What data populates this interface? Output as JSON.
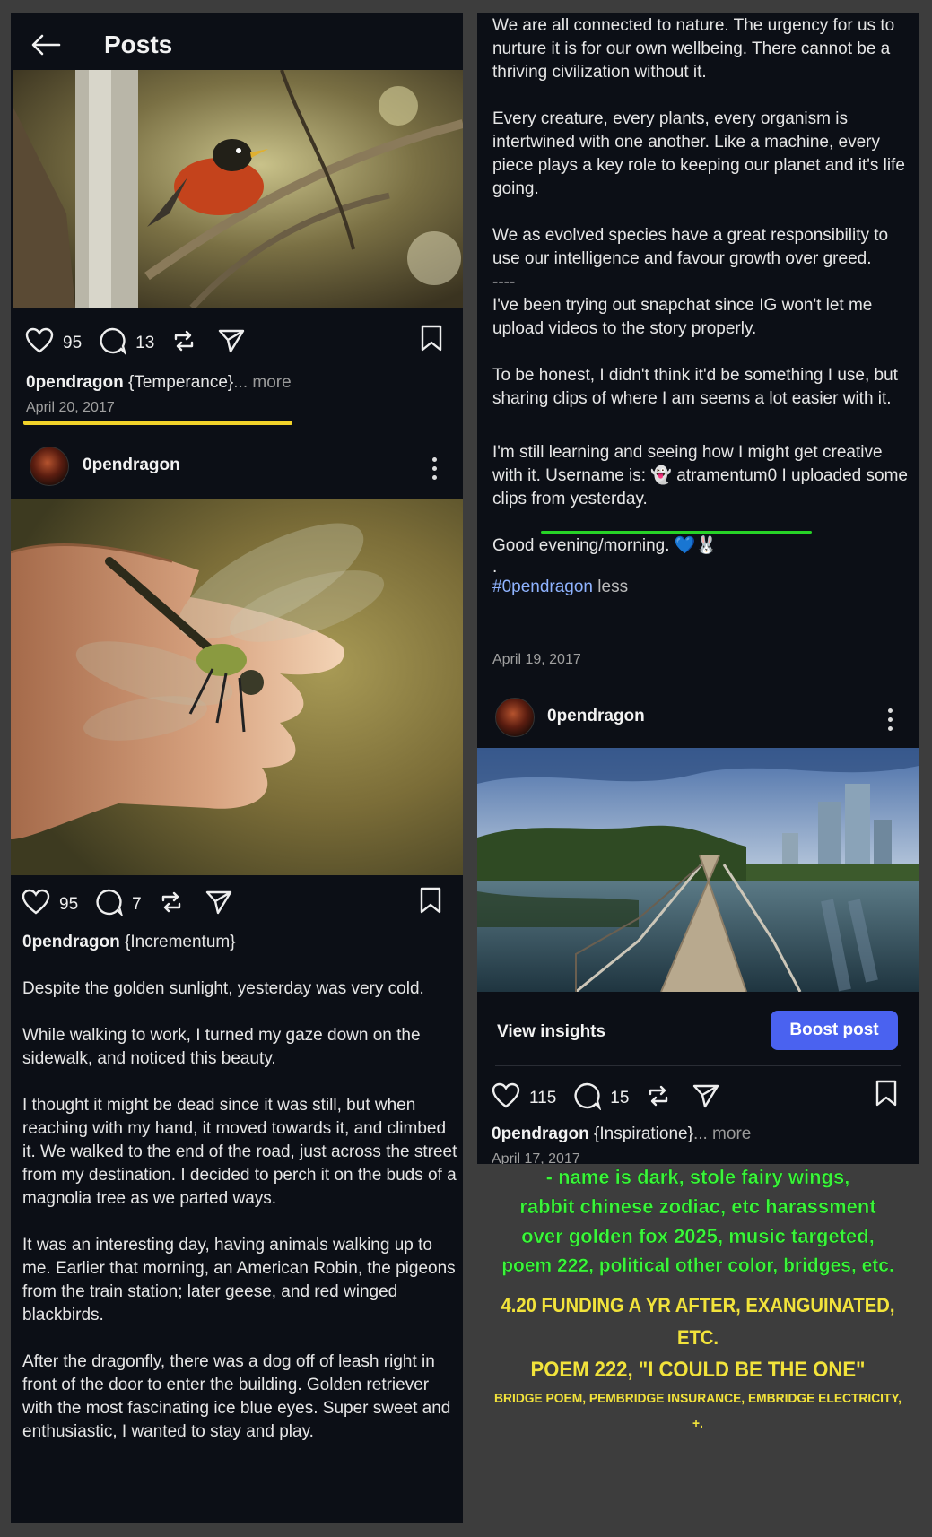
{
  "header": {
    "title": "Posts"
  },
  "post1": {
    "likes": "95",
    "comments": "13",
    "username": "0pendragon",
    "caption": " {Temperance}",
    "more": "... more",
    "date": "April 20, 2017"
  },
  "post2": {
    "username": "0pendragon",
    "likes": "95",
    "comments": "7",
    "caption_user": "0pendragon",
    "caption_title": " {Incrementum}",
    "paragraphs": [
      "Despite the golden sunlight, yesterday was very cold.",
      "While walking to work, I turned my gaze down on the sidewalk, and noticed this beauty.",
      "I thought it might be dead since it was still, but when reaching with my hand, it moved towards it, and climbed it. We walked to the end of the road, just across the street from my destination. I decided to perch it on the buds of a magnolia tree as we parted ways.",
      "It was an interesting day, having animals walking up to me. Earlier that morning, an American Robin, the pigeons from the train station; later geese, and red winged blackbirds.",
      "After the dragonfly, there was a dog off of leash right in front of the door to enter the building. Golden retriever with the most fascinating ice blue eyes. Super sweet and enthusiastic, I wanted to stay and play."
    ]
  },
  "right_caption": {
    "paragraphs": [
      "We are all connected to nature. The urgency for us to nurture it is for our own wellbeing. There cannot be a thriving civilization without it.",
      "Every creature, every plants, every organism is intertwined with one another. Like a machine, every piece plays a key role to keeping our planet and it's life going.",
      "We as evolved species have a great responsibility to use our intelligence and favour growth over greed.\n----\nI've been trying out snapchat since IG won't let me upload videos to the story properly.",
      "To be honest, I didn't think it'd be something I use, but sharing clips of where I am seems a lot easier with it."
    ],
    "snap_line_1": "I'm still learning and seeing how I might get creative with it. Username is: 👻 atramentum0 I uploaded some clips from yesterday.",
    "greeting": "Good evening/morning. 💙🐰",
    "dot": ".",
    "hashtag": "#0pendragon",
    "less": " less",
    "date": "April 19, 2017"
  },
  "post3": {
    "username": "0pendragon",
    "view_insights": "View insights",
    "boost": "Boost post",
    "likes": "115",
    "comments": "15",
    "caption_user": "0pendragon",
    "caption_title": " {Inspiratione}",
    "more": "... more",
    "date_partial": "April 17, 2017"
  },
  "annotations": {
    "green_lines": [
      "- name is dark, stole fairy wings,",
      "rabbit chinese zodiac, etc harassment",
      "over golden fox 2025, music targeted,",
      "poem 222, political other color, bridges, etc."
    ],
    "yellow_lines": [
      "4.20 FUNDING A YR AFTER, EXANGUINATED, ETC.",
      "POEM 222, \"I COULD BE THE ONE\"",
      "BRIDGE POEM, PEMBRIDGE INSURANCE, EMBRIDGE ELECTRICITY, +."
    ]
  },
  "colors": {
    "panel": "#0c0f16",
    "boost": "#4a62f0",
    "highlight_yellow": "#f2d32a",
    "highlight_green": "#27d327",
    "hashtag": "#8fb3ff"
  }
}
